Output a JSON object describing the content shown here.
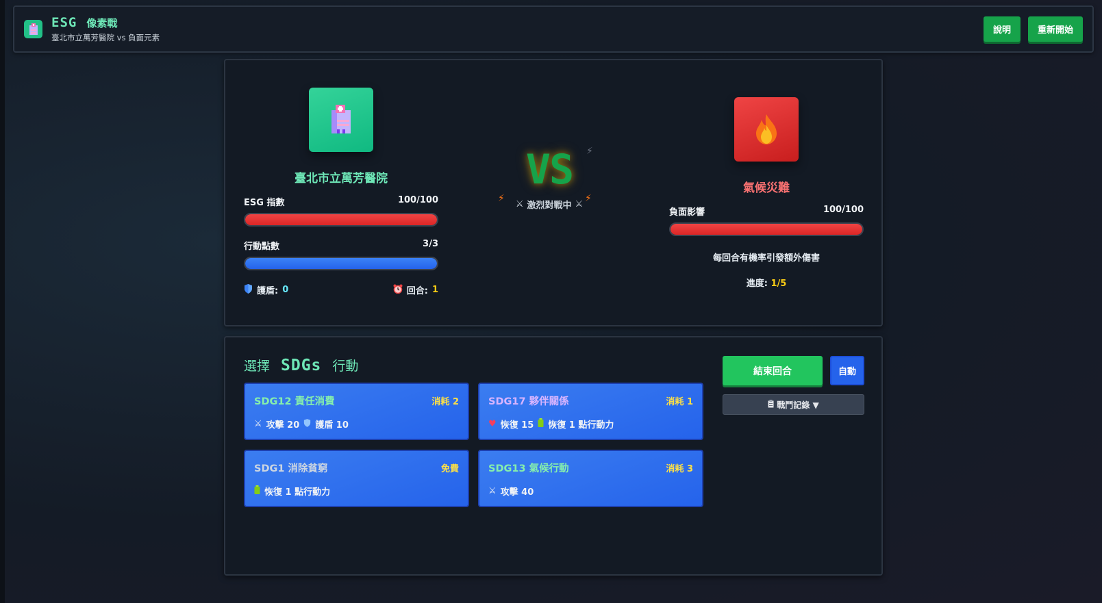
{
  "header": {
    "title_esg": "ESG",
    "title_sub": "像素戰",
    "subtitle": "臺北市立萬芳醫院 vs 負面元素",
    "help_label": "說明",
    "restart_label": "重新開始"
  },
  "player": {
    "name": "臺北市立萬芳醫院",
    "esg_label": "ESG 指數",
    "esg_value": "100/100",
    "esg_fraction": 1.0,
    "ap_label": "行動點數",
    "ap_value": "3/3",
    "ap_fraction": 1.0,
    "shield_label": "護盾:",
    "shield_value": "0",
    "round_label": "回合:",
    "round_value": "1",
    "icon": "hospital-icon"
  },
  "vs": {
    "text": "VS",
    "status": "激烈對戰中"
  },
  "enemy": {
    "name": "氣候災難",
    "impact_label": "負面影響",
    "impact_value": "100/100",
    "impact_fraction": 1.0,
    "note": "每回合有機率引發額外傷害",
    "progress_label": "進度:",
    "progress_value": "1/5",
    "icon": "fire-icon"
  },
  "actions": {
    "title_1": "選擇",
    "title_2": "SDGs",
    "title_3": "行動",
    "end_turn_label": "結束回合",
    "auto_label": "自動",
    "log_label": "戰鬥記錄 ▼",
    "cards": [
      {
        "name": "SDG12 責任消費",
        "cost": "消耗 2",
        "effect_1": "攻擊 20",
        "effect_2": "護盾 10"
      },
      {
        "name": "SDG17 夥伴關係",
        "cost": "消耗 1",
        "effect_1": "恢復 15",
        "effect_2": "恢復 1 點行動力"
      },
      {
        "name": "SDG1 消除貧窮",
        "cost": "免費",
        "effect_1": "恢復 1 點行動力"
      },
      {
        "name": "SDG13 氣候行動",
        "cost": "消耗 3",
        "effect_1": "攻擊 40"
      }
    ]
  },
  "colors": {
    "accent_green": "#6ee7b7",
    "enemy_red": "#f87171",
    "card_blue": "#2563eb",
    "cost_yellow": "#fde047"
  }
}
